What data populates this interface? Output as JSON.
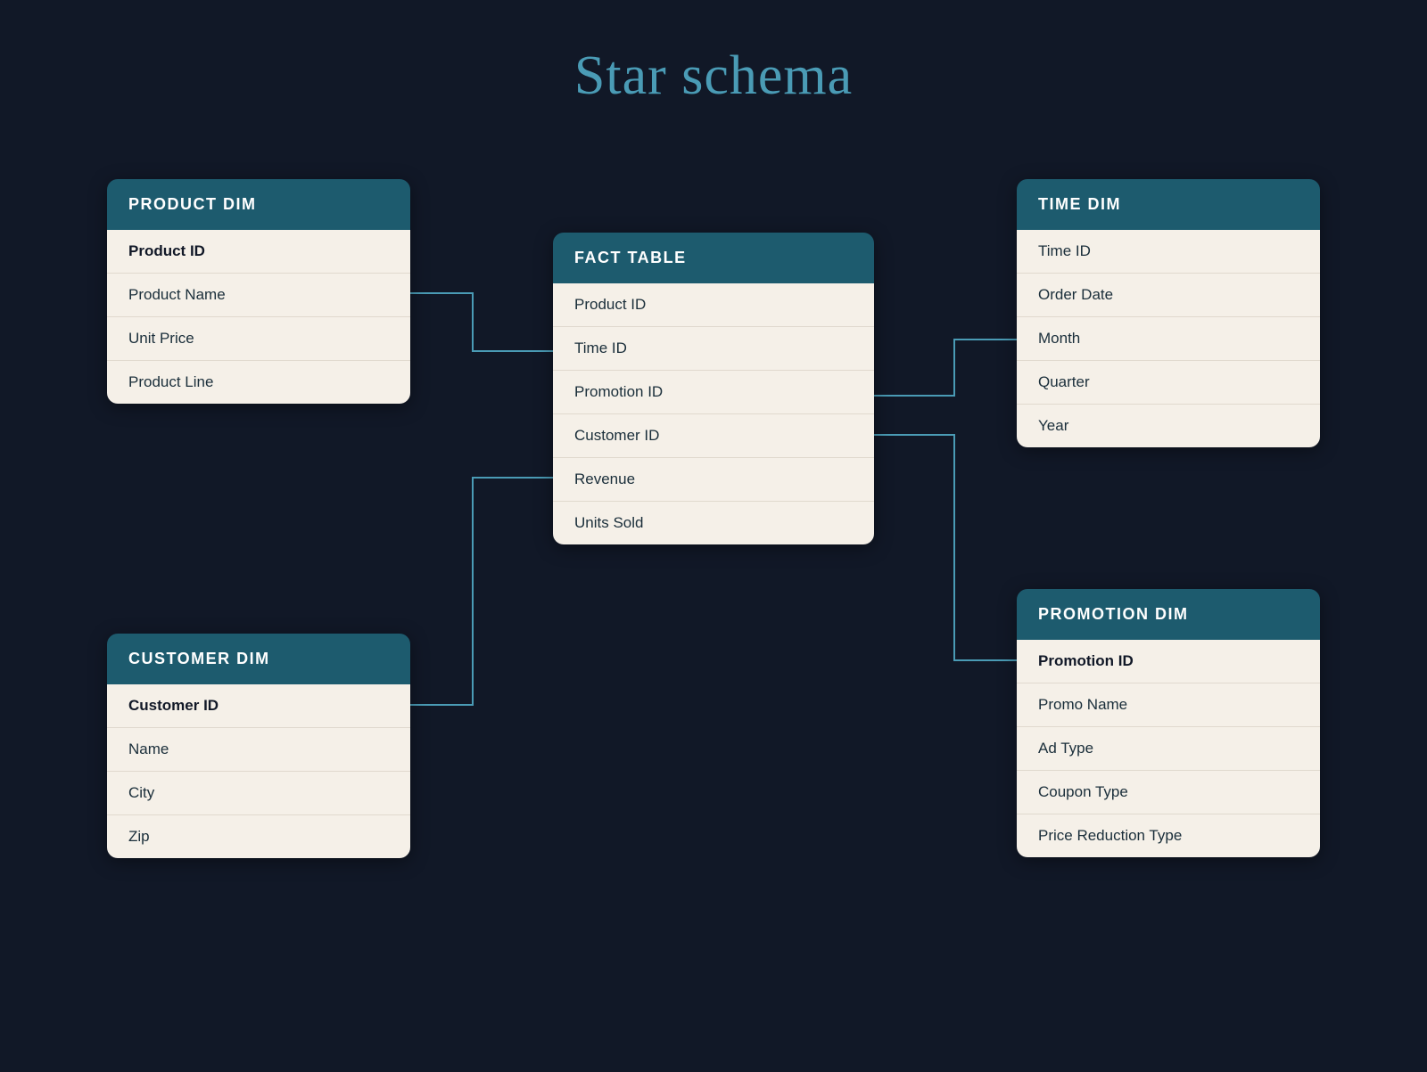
{
  "page": {
    "title": "Star schema",
    "background": "#111827"
  },
  "tables": {
    "product_dim": {
      "header": "PRODUCT DIM",
      "rows": [
        {
          "label": "Product ID",
          "bold": true
        },
        {
          "label": "Product Name",
          "bold": false
        },
        {
          "label": "Unit Price",
          "bold": false
        },
        {
          "label": "Product Line",
          "bold": false
        }
      ]
    },
    "time_dim": {
      "header": "TIME DIM",
      "rows": [
        {
          "label": "Time ID",
          "bold": false
        },
        {
          "label": "Order Date",
          "bold": false
        },
        {
          "label": "Month",
          "bold": false
        },
        {
          "label": "Quarter",
          "bold": false
        },
        {
          "label": "Year",
          "bold": false
        }
      ]
    },
    "fact_table": {
      "header": "FACT TABLE",
      "rows": [
        {
          "label": "Product ID",
          "bold": false
        },
        {
          "label": "Time ID",
          "bold": false
        },
        {
          "label": "Promotion ID",
          "bold": false
        },
        {
          "label": "Customer ID",
          "bold": false
        },
        {
          "label": "Revenue",
          "bold": false
        },
        {
          "label": "Units Sold",
          "bold": false
        }
      ]
    },
    "customer_dim": {
      "header": "CUSTOMER DIM",
      "rows": [
        {
          "label": "Customer ID",
          "bold": true
        },
        {
          "label": "Name",
          "bold": false
        },
        {
          "label": "City",
          "bold": false
        },
        {
          "label": "Zip",
          "bold": false
        }
      ]
    },
    "promotion_dim": {
      "header": "PROMOTION DIM",
      "rows": [
        {
          "label": "Promotion ID",
          "bold": true
        },
        {
          "label": "Promo Name",
          "bold": false
        },
        {
          "label": "Ad Type",
          "bold": false
        },
        {
          "label": "Coupon Type",
          "bold": false
        },
        {
          "label": "Price Reduction Type",
          "bold": false
        }
      ]
    }
  }
}
